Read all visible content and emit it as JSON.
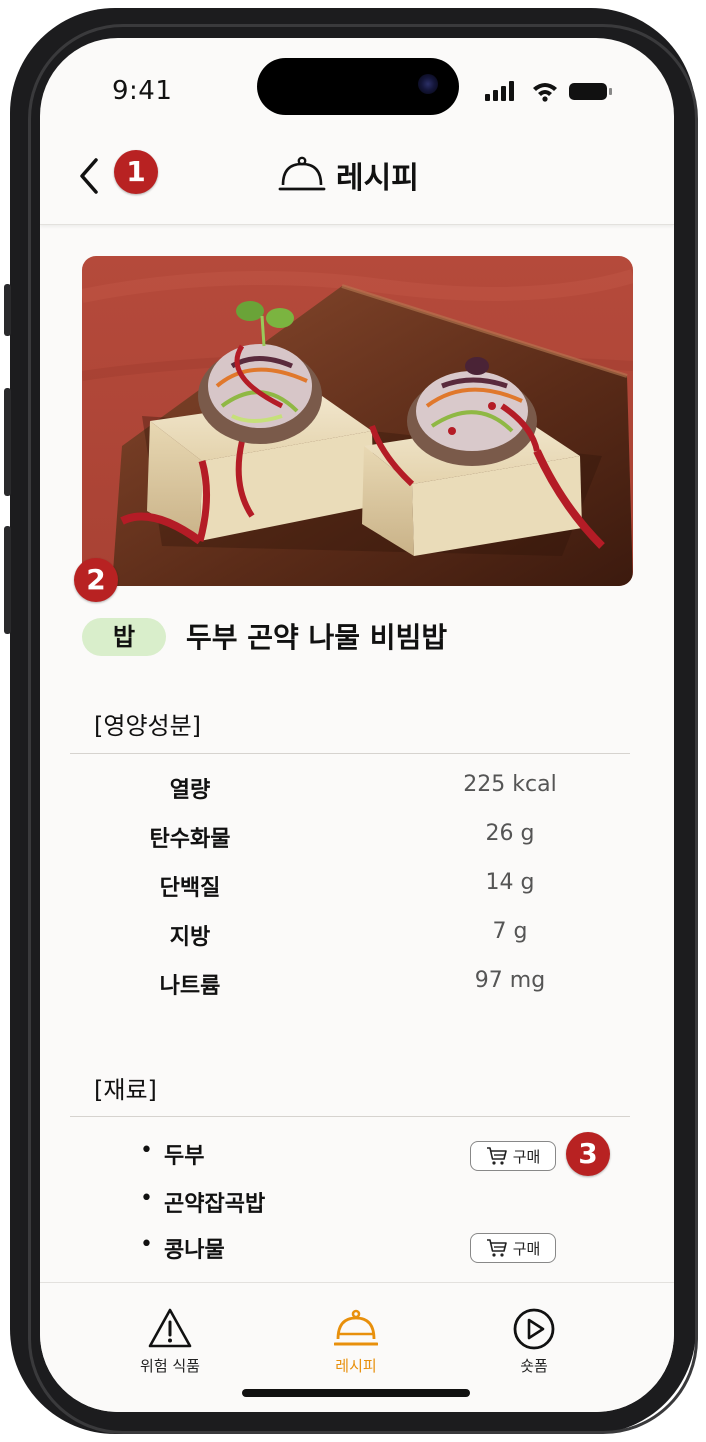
{
  "status_bar": {
    "time": "9:41"
  },
  "header": {
    "title": "레시피",
    "back_icon": "chevron-left-icon",
    "title_icon": "cloche-icon"
  },
  "annotations": [
    "1",
    "2",
    "3"
  ],
  "recipe": {
    "image": "tofu-konjac-bibimbap-photo",
    "category": "밥",
    "title": "두부 곤약 나물 비빔밥"
  },
  "nutrition": {
    "label": "[영양성분]",
    "rows": [
      {
        "name": "열량",
        "value": "225 kcal"
      },
      {
        "name": "탄수화물",
        "value": "26 g"
      },
      {
        "name": "단백질",
        "value": "14 g"
      },
      {
        "name": "지방",
        "value": "7 g"
      },
      {
        "name": "나트륨",
        "value": "97 mg"
      }
    ]
  },
  "ingredients": {
    "label": "[재료]",
    "bullet": "•",
    "buy_label": "구매",
    "items": [
      {
        "name": "두부",
        "buyable": true
      },
      {
        "name": "곤약잡곡밥",
        "buyable": false
      },
      {
        "name": "콩나물",
        "buyable": true
      }
    ]
  },
  "tabbar": {
    "tabs": [
      {
        "label": "위험 식품",
        "icon": "warning-icon",
        "active": false
      },
      {
        "label": "레시피",
        "icon": "cloche-icon",
        "active": true
      },
      {
        "label": "숏폼",
        "icon": "play-circle-icon",
        "active": false
      }
    ]
  },
  "colors": {
    "accent": "#e8900c",
    "badge": "#b82222",
    "pill": "#d9eecb"
  }
}
